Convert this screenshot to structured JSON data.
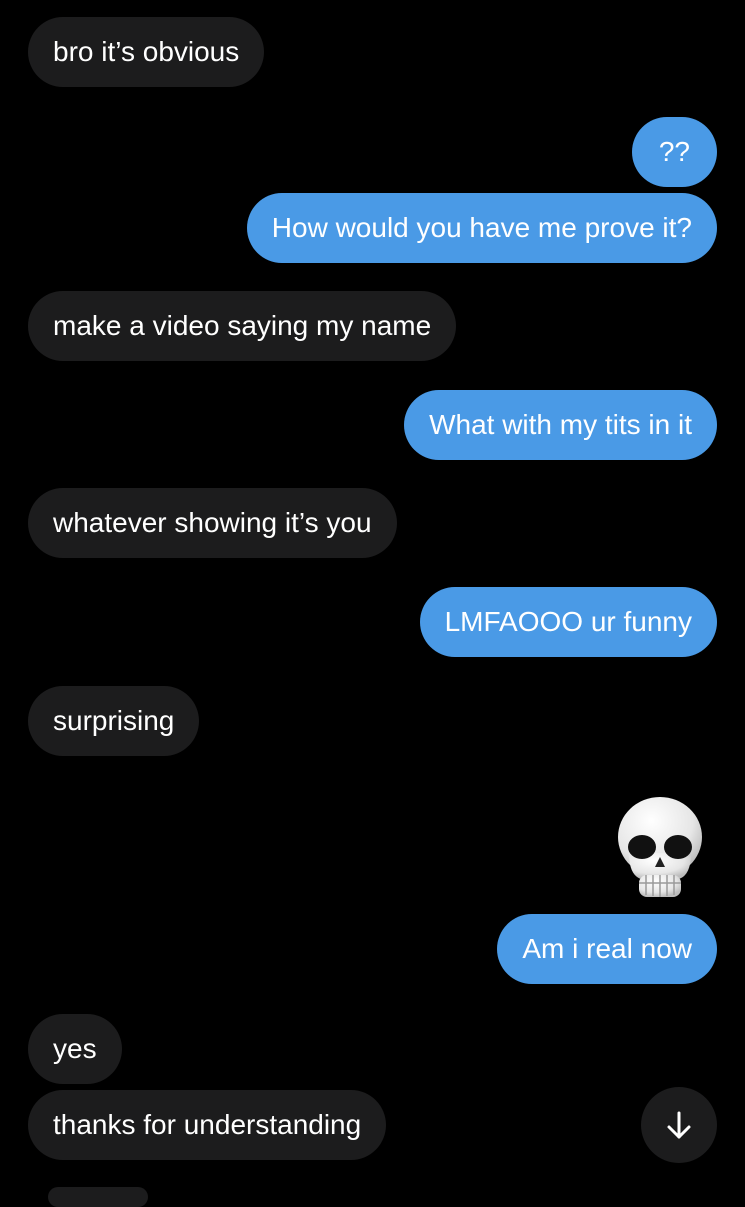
{
  "messages": [
    {
      "side": "received",
      "text": "bro it’s obvious"
    },
    {
      "side": "sent",
      "text": "??"
    },
    {
      "side": "sent",
      "text": "How would you have me prove it?"
    },
    {
      "side": "received",
      "text": "make a video saying my name"
    },
    {
      "side": "sent",
      "text": "What with my tits in it"
    },
    {
      "side": "received",
      "text": "whatever showing it’s you"
    },
    {
      "side": "sent",
      "text": "LMFAOOO ur funny"
    },
    {
      "side": "received",
      "text": "surprising"
    },
    {
      "side": "sent",
      "emoji": "skull-emoji"
    },
    {
      "side": "sent",
      "text": "Am i real now"
    },
    {
      "side": "received",
      "text": "yes"
    },
    {
      "side": "received",
      "text": "thanks for understanding"
    }
  ],
  "scroll_button": {
    "icon": "arrow-down-icon"
  },
  "colors": {
    "background": "#000000",
    "received_bubble": "#1c1c1d",
    "sent_bubble": "#4a9ae6",
    "text": "#ffffff"
  }
}
